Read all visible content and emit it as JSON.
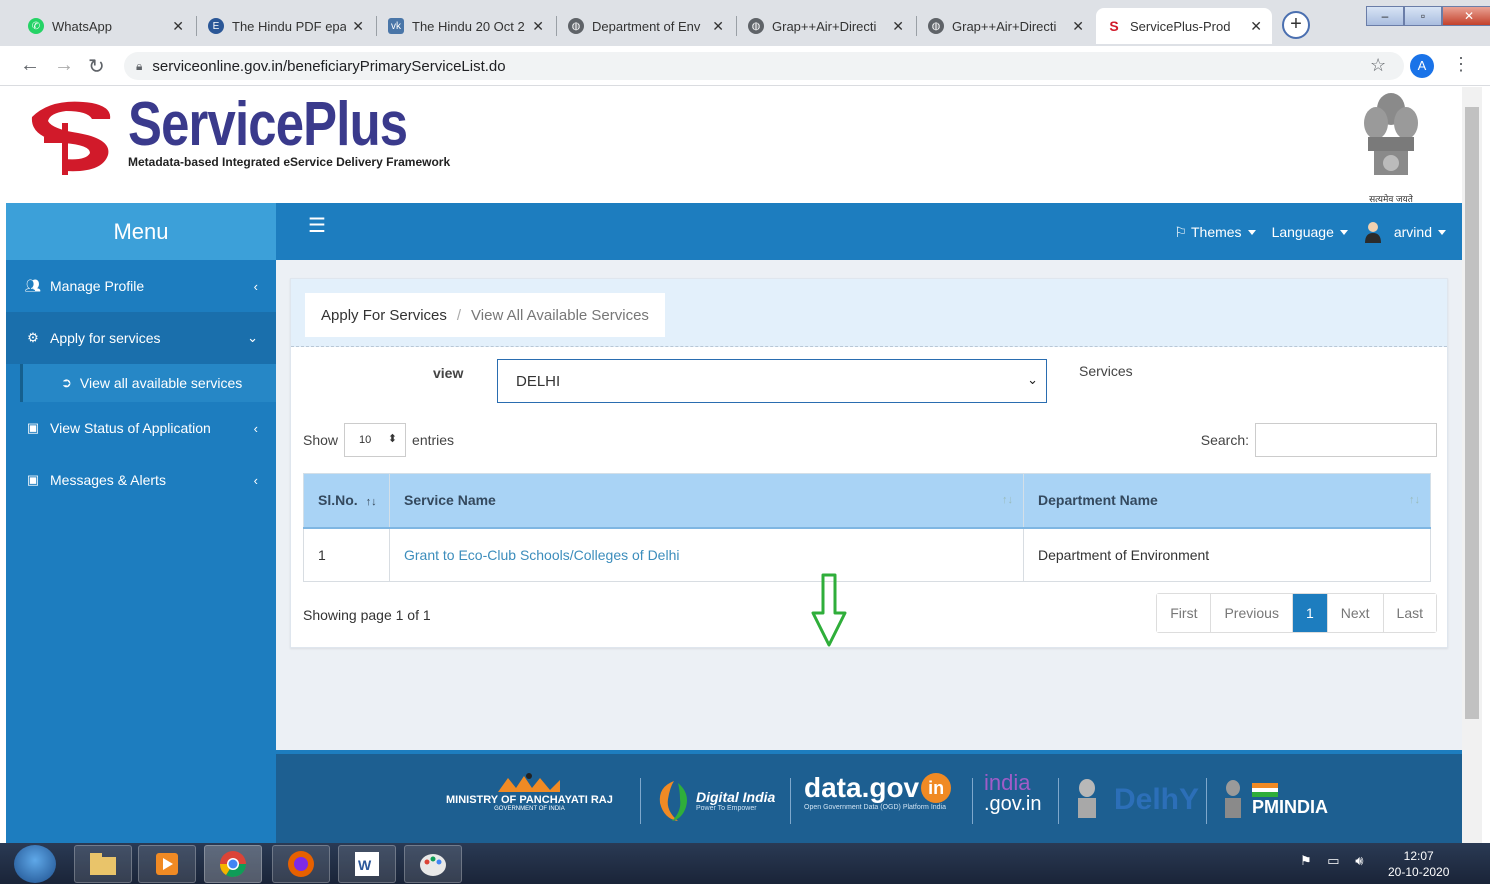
{
  "browser": {
    "tabs": [
      {
        "title": "WhatsApp",
        "icon": "whatsapp-icon",
        "color": "#25d366"
      },
      {
        "title": "The Hindu PDF epa",
        "icon": "e-circle-icon",
        "color": "#2b5797"
      },
      {
        "title": "The Hindu 20 Oct 2",
        "icon": "vk-icon",
        "color": "#4a76a8"
      },
      {
        "title": "Department of Env",
        "icon": "globe-icon",
        "color": "#5f6368"
      },
      {
        "title": "Grap++Air+Directi",
        "icon": "globe-icon",
        "color": "#5f6368"
      },
      {
        "title": "Grap++Air+Directi",
        "icon": "globe-icon",
        "color": "#5f6368"
      },
      {
        "title": "ServicePlus-Prod",
        "icon": "serviceplus-icon",
        "color": "#d11a2a",
        "active": true
      }
    ],
    "url": "serviceonline.gov.in/beneficiaryPrimaryServiceList.do",
    "profile_initial": "A"
  },
  "header": {
    "brand": "ServicePlus",
    "tagline": "Metadata-based Integrated eService Delivery Framework",
    "emblem_caption": "सत्यमेव जयते"
  },
  "menu": {
    "title": "Menu",
    "items": [
      {
        "label": "Manage Profile",
        "icon": "users-icon"
      },
      {
        "label": "Apply for services",
        "icon": "gears-icon",
        "open": true
      },
      {
        "label": "View Status of Application",
        "icon": "window-icon"
      },
      {
        "label": "Messages & Alerts",
        "icon": "window-icon"
      }
    ],
    "sub_item": "View all available services"
  },
  "topbar": {
    "themes": "Themes",
    "language": "Language",
    "user": "arvind"
  },
  "breadcrumb": {
    "first": "Apply For Services",
    "second": "View All Available Services"
  },
  "filter": {
    "view_label": "view",
    "view_value": "DELHI",
    "services_label": "Services"
  },
  "table_controls": {
    "show": "Show",
    "length": "10",
    "entries": "entries",
    "search": "Search:"
  },
  "table": {
    "headers": [
      "Sl.No.",
      "Service Name",
      "Department Name"
    ],
    "rows": [
      {
        "sl": "1",
        "service": "Grant to Eco-Club Schools/Colleges of Delhi",
        "department": "Department of Environment"
      }
    ]
  },
  "pagination": {
    "showing": "Showing page 1 of 1",
    "first": "First",
    "previous": "Previous",
    "current": "1",
    "next": "Next",
    "last": "Last"
  },
  "footer": {
    "panchayati": "MINISTRY OF PANCHAYATI RAJ",
    "panchayati_sub": "GOVERNMENT OF INDIA",
    "digital_india": "Digital India",
    "digital_india_sub": "Power To Empower",
    "datagov": "data.gov",
    "datagov_in": "in",
    "datagov_sub": "Open Government Data (OGD) Platform India",
    "indiagov": "india",
    "indiagov_sub": ".gov.in",
    "delhi": "DelhY",
    "pmindia": "PMINDIA"
  },
  "taskbar": {
    "time": "12:07",
    "date": "20-10-2020"
  },
  "colors": {
    "sidebar": "#1d7dbf",
    "menu_head": "#3ca0d9",
    "table_header": "#a9d3f5",
    "pager_active": "#1d7dbf",
    "arrow": "#2fae3a"
  }
}
